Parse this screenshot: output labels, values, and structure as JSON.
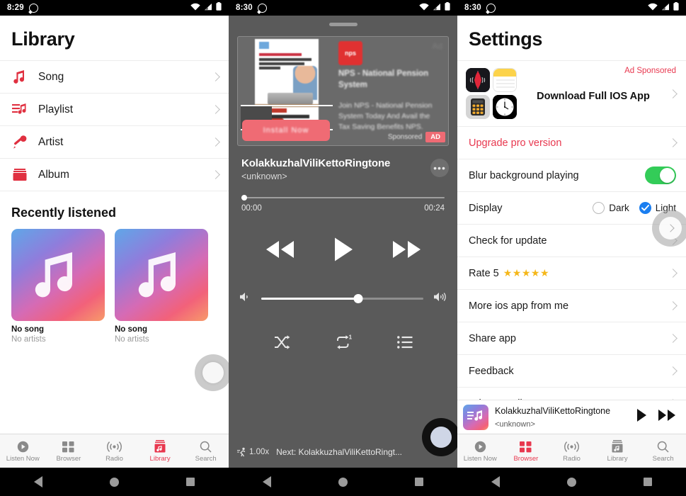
{
  "library": {
    "status": {
      "time": "8:29",
      "whatsapp_icon": "whatsapp-icon",
      "wifi_icon": "wifi-icon",
      "signal_icon": "signal-icon",
      "battery_icon": "battery-icon"
    },
    "title": "Library",
    "rows": [
      {
        "label": "Song",
        "icon": "music-note-icon"
      },
      {
        "label": "Playlist",
        "icon": "playlist-icon"
      },
      {
        "label": "Artist",
        "icon": "microphone-icon"
      },
      {
        "label": "Album",
        "icon": "album-icon"
      }
    ],
    "recent_heading": "Recently listened",
    "cards": [
      {
        "title": "No song",
        "subtitle": "No artists"
      },
      {
        "title": "No song",
        "subtitle": "No artists"
      }
    ],
    "tabs": [
      {
        "label": "Listen Now",
        "icon": "play-circle-icon",
        "active": false
      },
      {
        "label": "Browser",
        "icon": "grid-icon",
        "active": false
      },
      {
        "label": "Radio",
        "icon": "radio-waves-icon",
        "active": false
      },
      {
        "label": "Library",
        "icon": "library-icon",
        "active": true
      },
      {
        "label": "Search",
        "icon": "search-icon",
        "active": false
      }
    ]
  },
  "player": {
    "status": {
      "time": "8:30"
    },
    "ad": {
      "logo_text": "nps",
      "headline": "NPS - National Pension System",
      "description": "Join NPS - National Pension System Today And Avail the Tax Saving Benefits NPS.",
      "cta": "Install Now",
      "sponsored_label": "Sponsored",
      "badge": "AD",
      "ghost_text": "Ad"
    },
    "track_title": "KolakkuzhalViliKettoRingtone",
    "track_artist": "<unknown>",
    "more_glyph": "•••",
    "elapsed": "00:00",
    "duration": "00:24",
    "progress_pct": 1,
    "volume_pct": 60,
    "controls": {
      "prev": "rewind-icon",
      "play": "play-icon",
      "next": "fast-forward-icon"
    },
    "modes": {
      "shuffle": "shuffle-icon",
      "repeat": "repeat-one-icon",
      "queue": "queue-list-icon"
    },
    "speed": "1.00x",
    "next_up": "Next: KolakkuzhalViliKettoRingt..."
  },
  "settings": {
    "status": {
      "time": "8:30"
    },
    "title": "Settings",
    "ad": {
      "sponsored_label": "Ad Sponsored",
      "cta": "Download Full IOS App",
      "icons": [
        "voice-memos-icon",
        "notes-icon",
        "calculator-icon",
        "clock-icon"
      ]
    },
    "rows": [
      {
        "label": "Upgrade pro version",
        "type": "chevron",
        "red": true
      },
      {
        "label": "Blur background playing",
        "type": "switch",
        "value": "on"
      },
      {
        "label": "Display",
        "type": "radio",
        "options": [
          {
            "label": "Dark",
            "selected": false
          },
          {
            "label": "Light",
            "selected": true
          }
        ]
      },
      {
        "label": "Check for update",
        "type": "chevron",
        "red": false
      },
      {
        "label": "Rate 5",
        "type": "stars",
        "stars": "★★★★★",
        "red": false
      },
      {
        "label": "More ios app from me",
        "type": "chevron",
        "red": false
      },
      {
        "label": "Share app",
        "type": "chevron",
        "red": false
      },
      {
        "label": "Feedback",
        "type": "chevron",
        "red": false
      },
      {
        "label": "Privacy Policy",
        "type": "chevron",
        "red": false
      }
    ],
    "mini_player": {
      "title": "KolakkuzhalViliKettoRingtone",
      "artist": "<unknown>",
      "play": "play-icon",
      "next": "fast-forward-icon"
    },
    "tabs": [
      {
        "label": "Listen Now",
        "icon": "play-circle-icon",
        "active": false
      },
      {
        "label": "Browser",
        "icon": "grid-icon",
        "active": true
      },
      {
        "label": "Radio",
        "icon": "radio-waves-icon",
        "active": false
      },
      {
        "label": "Library",
        "icon": "library-icon",
        "active": false
      },
      {
        "label": "Search",
        "icon": "search-icon",
        "active": false
      }
    ]
  },
  "android_nav": {
    "back": "back-triangle-icon",
    "home": "home-circle-icon",
    "recents": "recents-square-icon"
  },
  "colors": {
    "accent_red": "#e8384f",
    "toggle_green": "#33cc58",
    "radio_blue": "#1a7ef0",
    "star_gold": "#f5b719"
  }
}
